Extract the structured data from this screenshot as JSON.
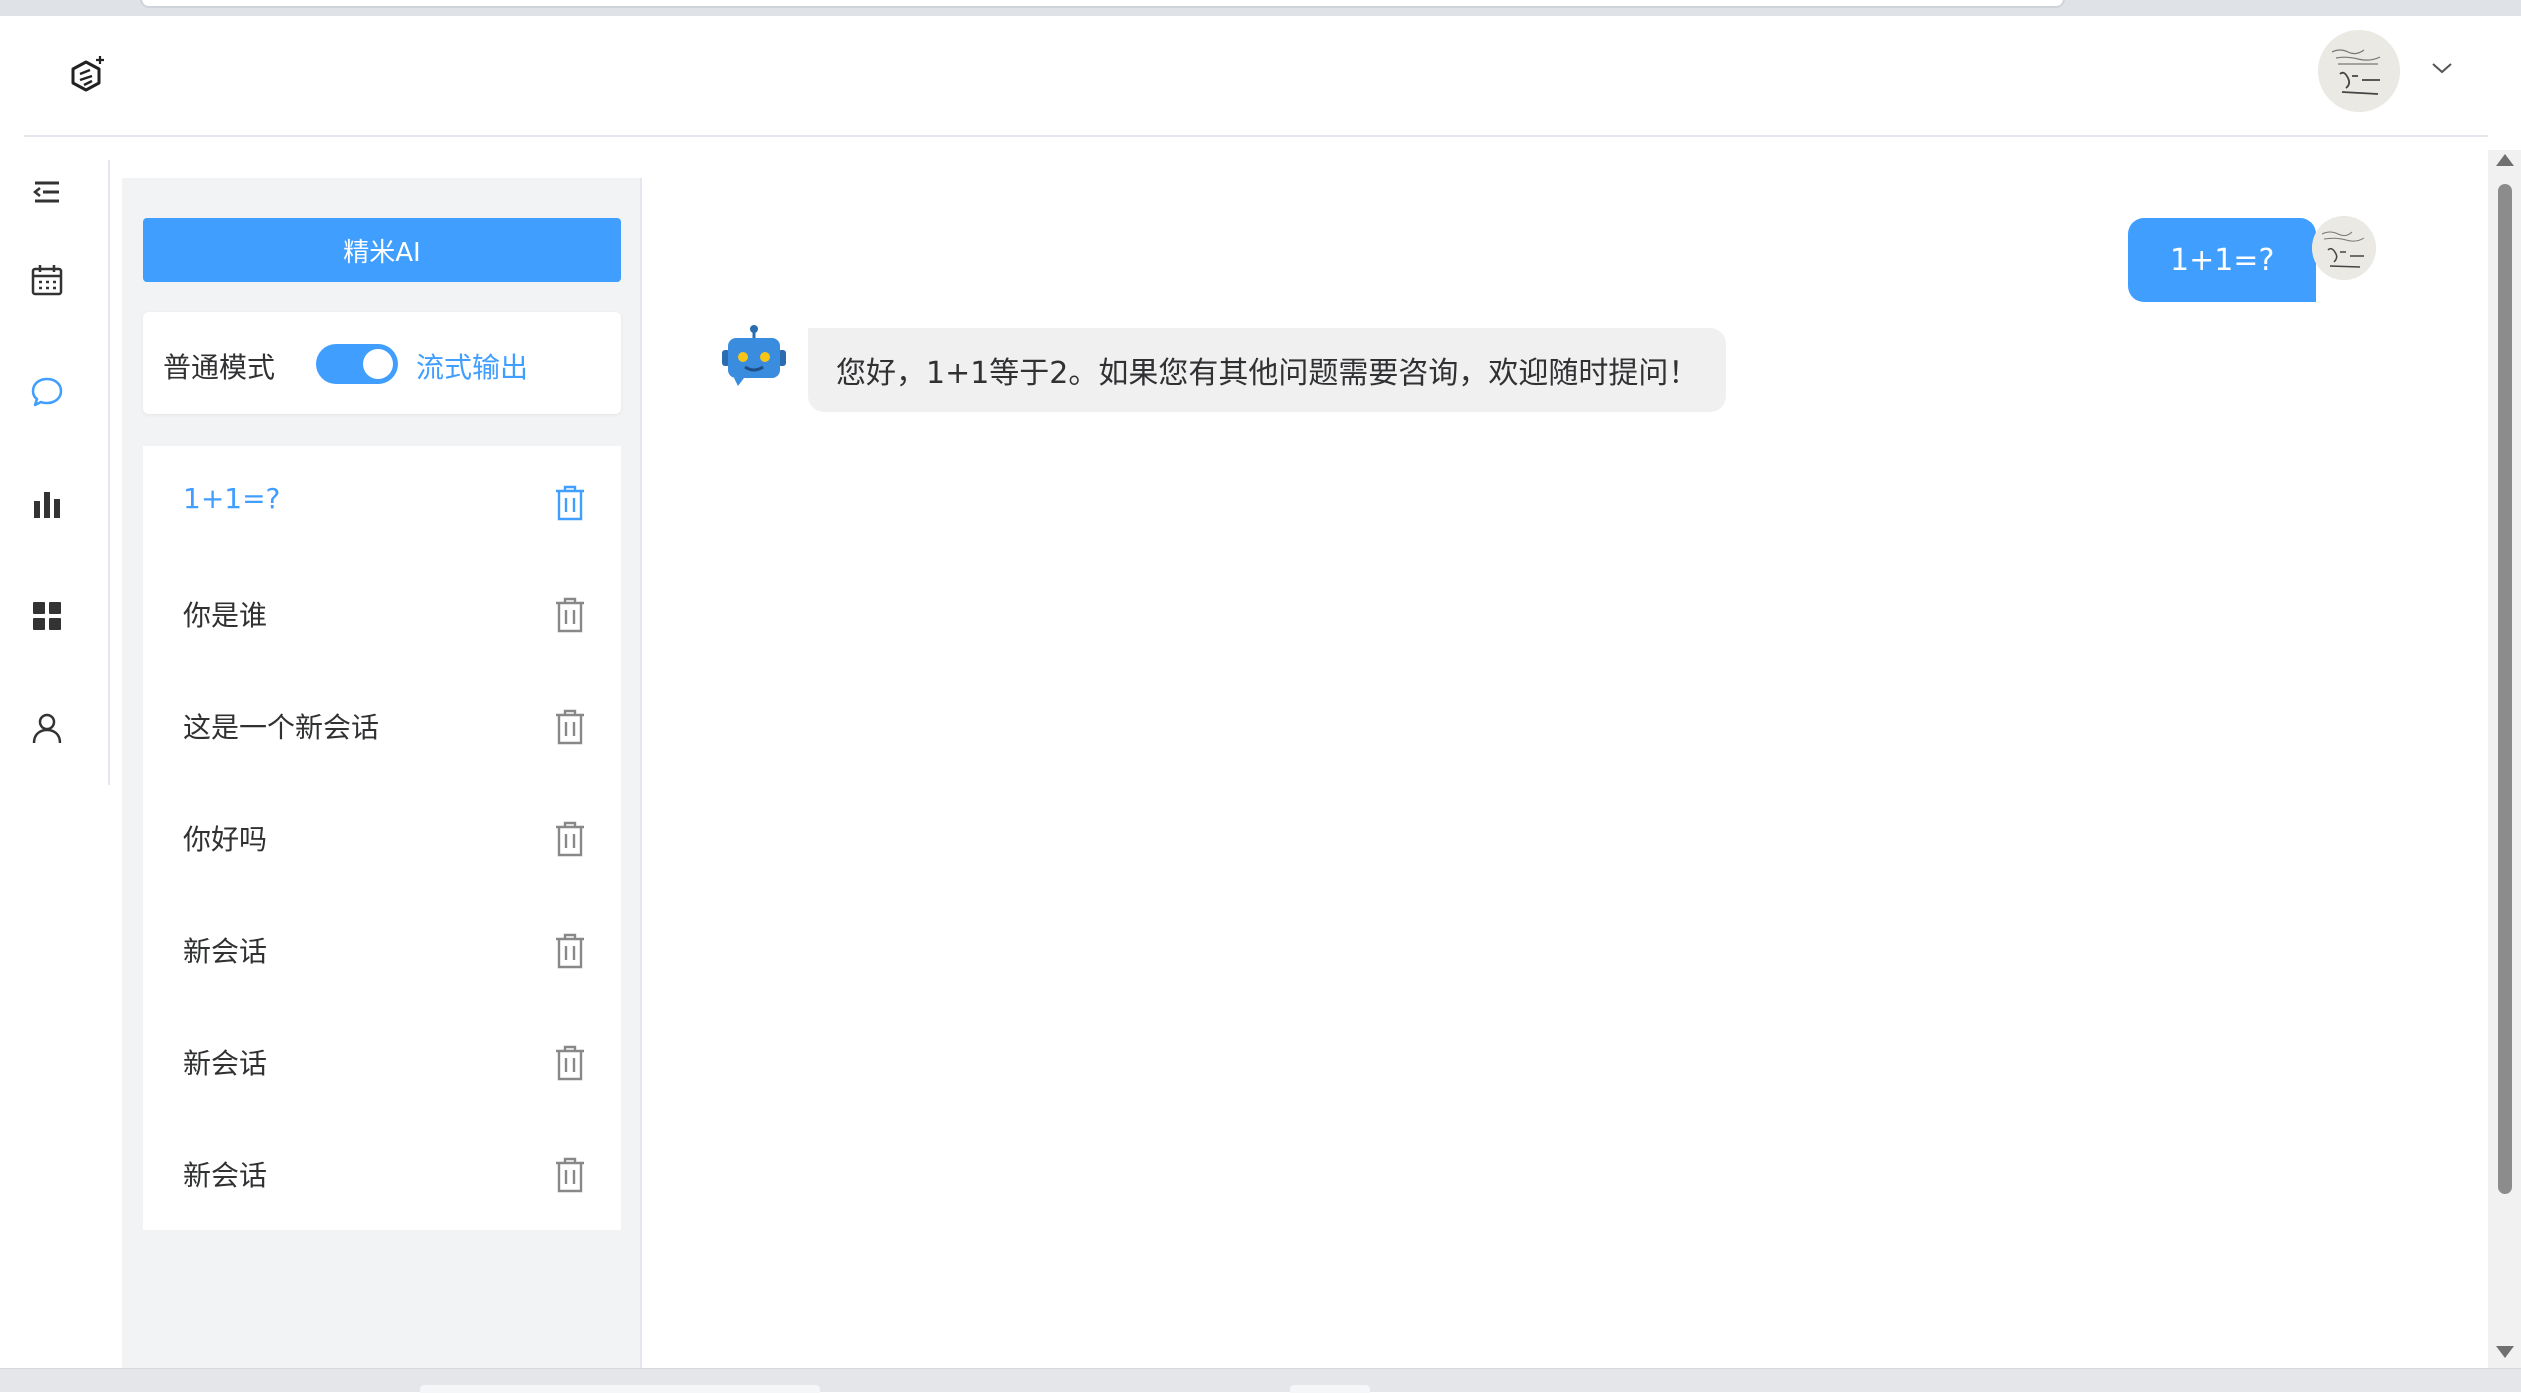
{
  "sidebar_nav": {
    "items": [
      {
        "name": "menu-toggle",
        "icon": "menu-fold-icon"
      },
      {
        "name": "calendar",
        "icon": "calendar-icon"
      },
      {
        "name": "chat",
        "icon": "chat-bubble-icon",
        "active": true
      },
      {
        "name": "statistics",
        "icon": "bar-chart-icon"
      },
      {
        "name": "apps",
        "icon": "grid-icon"
      },
      {
        "name": "user",
        "icon": "user-icon"
      }
    ]
  },
  "panel": {
    "new_chat_label": "精米AI",
    "mode": {
      "left_label": "普通模式",
      "right_label": "流式输出",
      "stream_enabled": true
    },
    "conversations": [
      {
        "title": "1+1=?",
        "active": true
      },
      {
        "title": "你是谁",
        "active": false
      },
      {
        "title": "这是一个新会话",
        "active": false
      },
      {
        "title": "你好吗",
        "active": false
      },
      {
        "title": "新会话",
        "active": false
      },
      {
        "title": "新会话",
        "active": false
      },
      {
        "title": "新会话",
        "active": false
      }
    ]
  },
  "chat": {
    "messages": [
      {
        "role": "user",
        "text": "1+1=?"
      },
      {
        "role": "assistant",
        "text": "您好，1+1等于2。如果您有其他问题需要咨询，欢迎随时提问！"
      }
    ]
  },
  "colors": {
    "accent": "#409eff",
    "panel_bg": "#f2f3f5",
    "bot_bubble": "#f0f0f0"
  }
}
